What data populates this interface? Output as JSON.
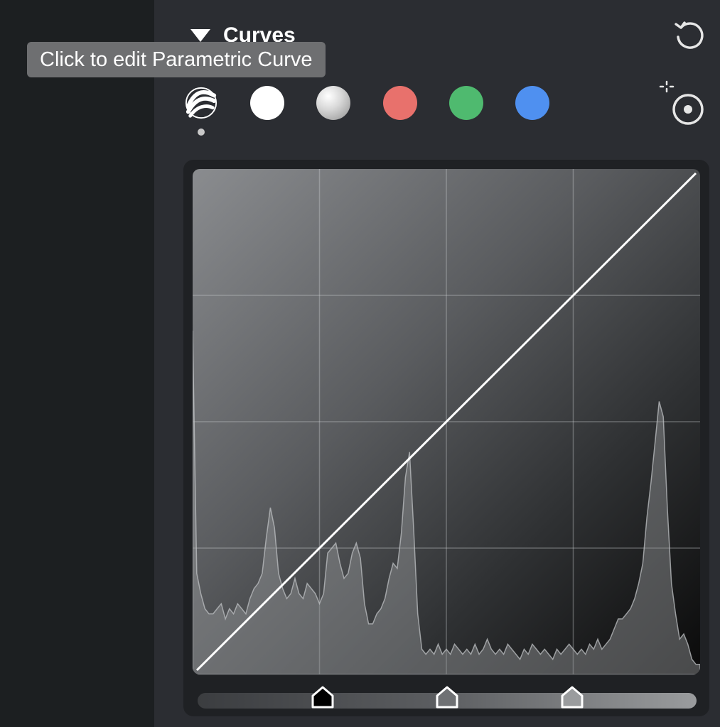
{
  "section": {
    "title": "Curves"
  },
  "tooltip": {
    "text": "Click to edit Parametric Curve"
  },
  "channels": [
    {
      "id": "parametric",
      "icon": "parametric-curve-icon",
      "selected": true
    },
    {
      "id": "rgb",
      "color": "#ffffff"
    },
    {
      "id": "luminance",
      "color": "#c8c8c8"
    },
    {
      "id": "red",
      "color": "#e8716c"
    },
    {
      "id": "green",
      "color": "#4fba6f"
    },
    {
      "id": "blue",
      "color": "#4f90f0"
    }
  ],
  "icons": {
    "collapse": "triangle-down-icon",
    "reset": "reset-icon",
    "target": "targeted-adjustment-icon"
  },
  "curve": {
    "points": [
      [
        0,
        0
      ],
      [
        1,
        1
      ]
    ],
    "grid_divisions": 4,
    "line_color": "#ffffff",
    "histogram": [
      0.68,
      0.2,
      0.16,
      0.13,
      0.12,
      0.12,
      0.13,
      0.14,
      0.11,
      0.13,
      0.12,
      0.14,
      0.13,
      0.12,
      0.15,
      0.17,
      0.18,
      0.2,
      0.27,
      0.33,
      0.29,
      0.2,
      0.17,
      0.15,
      0.16,
      0.19,
      0.16,
      0.15,
      0.18,
      0.17,
      0.16,
      0.14,
      0.16,
      0.24,
      0.25,
      0.26,
      0.22,
      0.19,
      0.2,
      0.24,
      0.26,
      0.23,
      0.14,
      0.1,
      0.1,
      0.12,
      0.13,
      0.15,
      0.19,
      0.22,
      0.21,
      0.28,
      0.39,
      0.44,
      0.29,
      0.12,
      0.05,
      0.04,
      0.05,
      0.04,
      0.06,
      0.04,
      0.05,
      0.04,
      0.06,
      0.05,
      0.04,
      0.05,
      0.04,
      0.06,
      0.04,
      0.05,
      0.07,
      0.05,
      0.04,
      0.05,
      0.04,
      0.06,
      0.05,
      0.04,
      0.03,
      0.05,
      0.04,
      0.06,
      0.05,
      0.04,
      0.05,
      0.04,
      0.03,
      0.05,
      0.04,
      0.05,
      0.06,
      0.05,
      0.04,
      0.05,
      0.04,
      0.06,
      0.05,
      0.07,
      0.05,
      0.06,
      0.07,
      0.09,
      0.11,
      0.11,
      0.12,
      0.13,
      0.15,
      0.18,
      0.22,
      0.31,
      0.38,
      0.46,
      0.54,
      0.51,
      0.33,
      0.18,
      0.12,
      0.07,
      0.08,
      0.06,
      0.03,
      0.02,
      0.02
    ]
  },
  "slider": {
    "handles": [
      {
        "name": "black-point",
        "value": 0.25,
        "fill": "#000000"
      },
      {
        "name": "midtone",
        "value": 0.5,
        "fill": "#6f7174"
      },
      {
        "name": "white-point",
        "value": 0.75,
        "fill": "#9a9c9e"
      }
    ]
  }
}
